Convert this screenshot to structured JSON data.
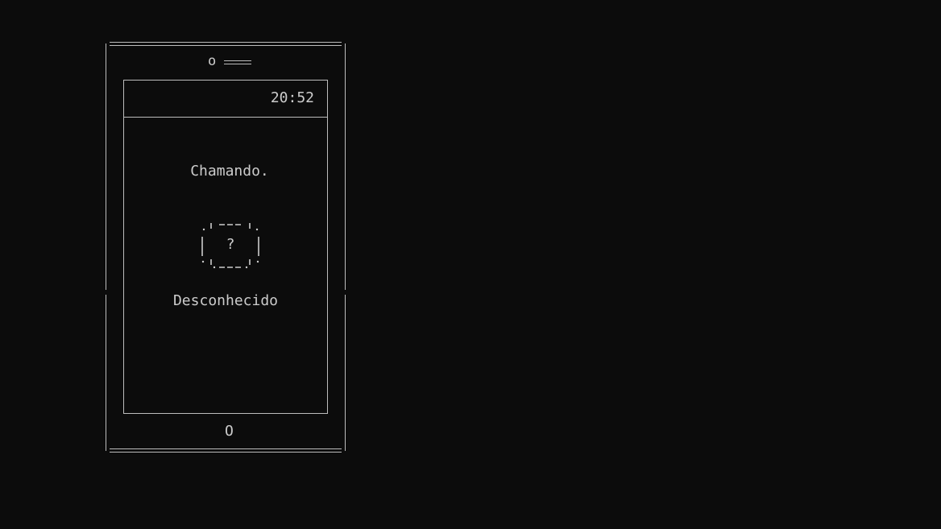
{
  "phone": {
    "camera_label": "o",
    "clock": "20:52",
    "call_status": "Chamando.",
    "avatar_placeholder": "?",
    "caller_name": "Desconhecido",
    "home_button_label": "O"
  },
  "colors": {
    "background": "#0c0c0c",
    "foreground": "#cccccc",
    "frame": "#bdbdbd"
  }
}
